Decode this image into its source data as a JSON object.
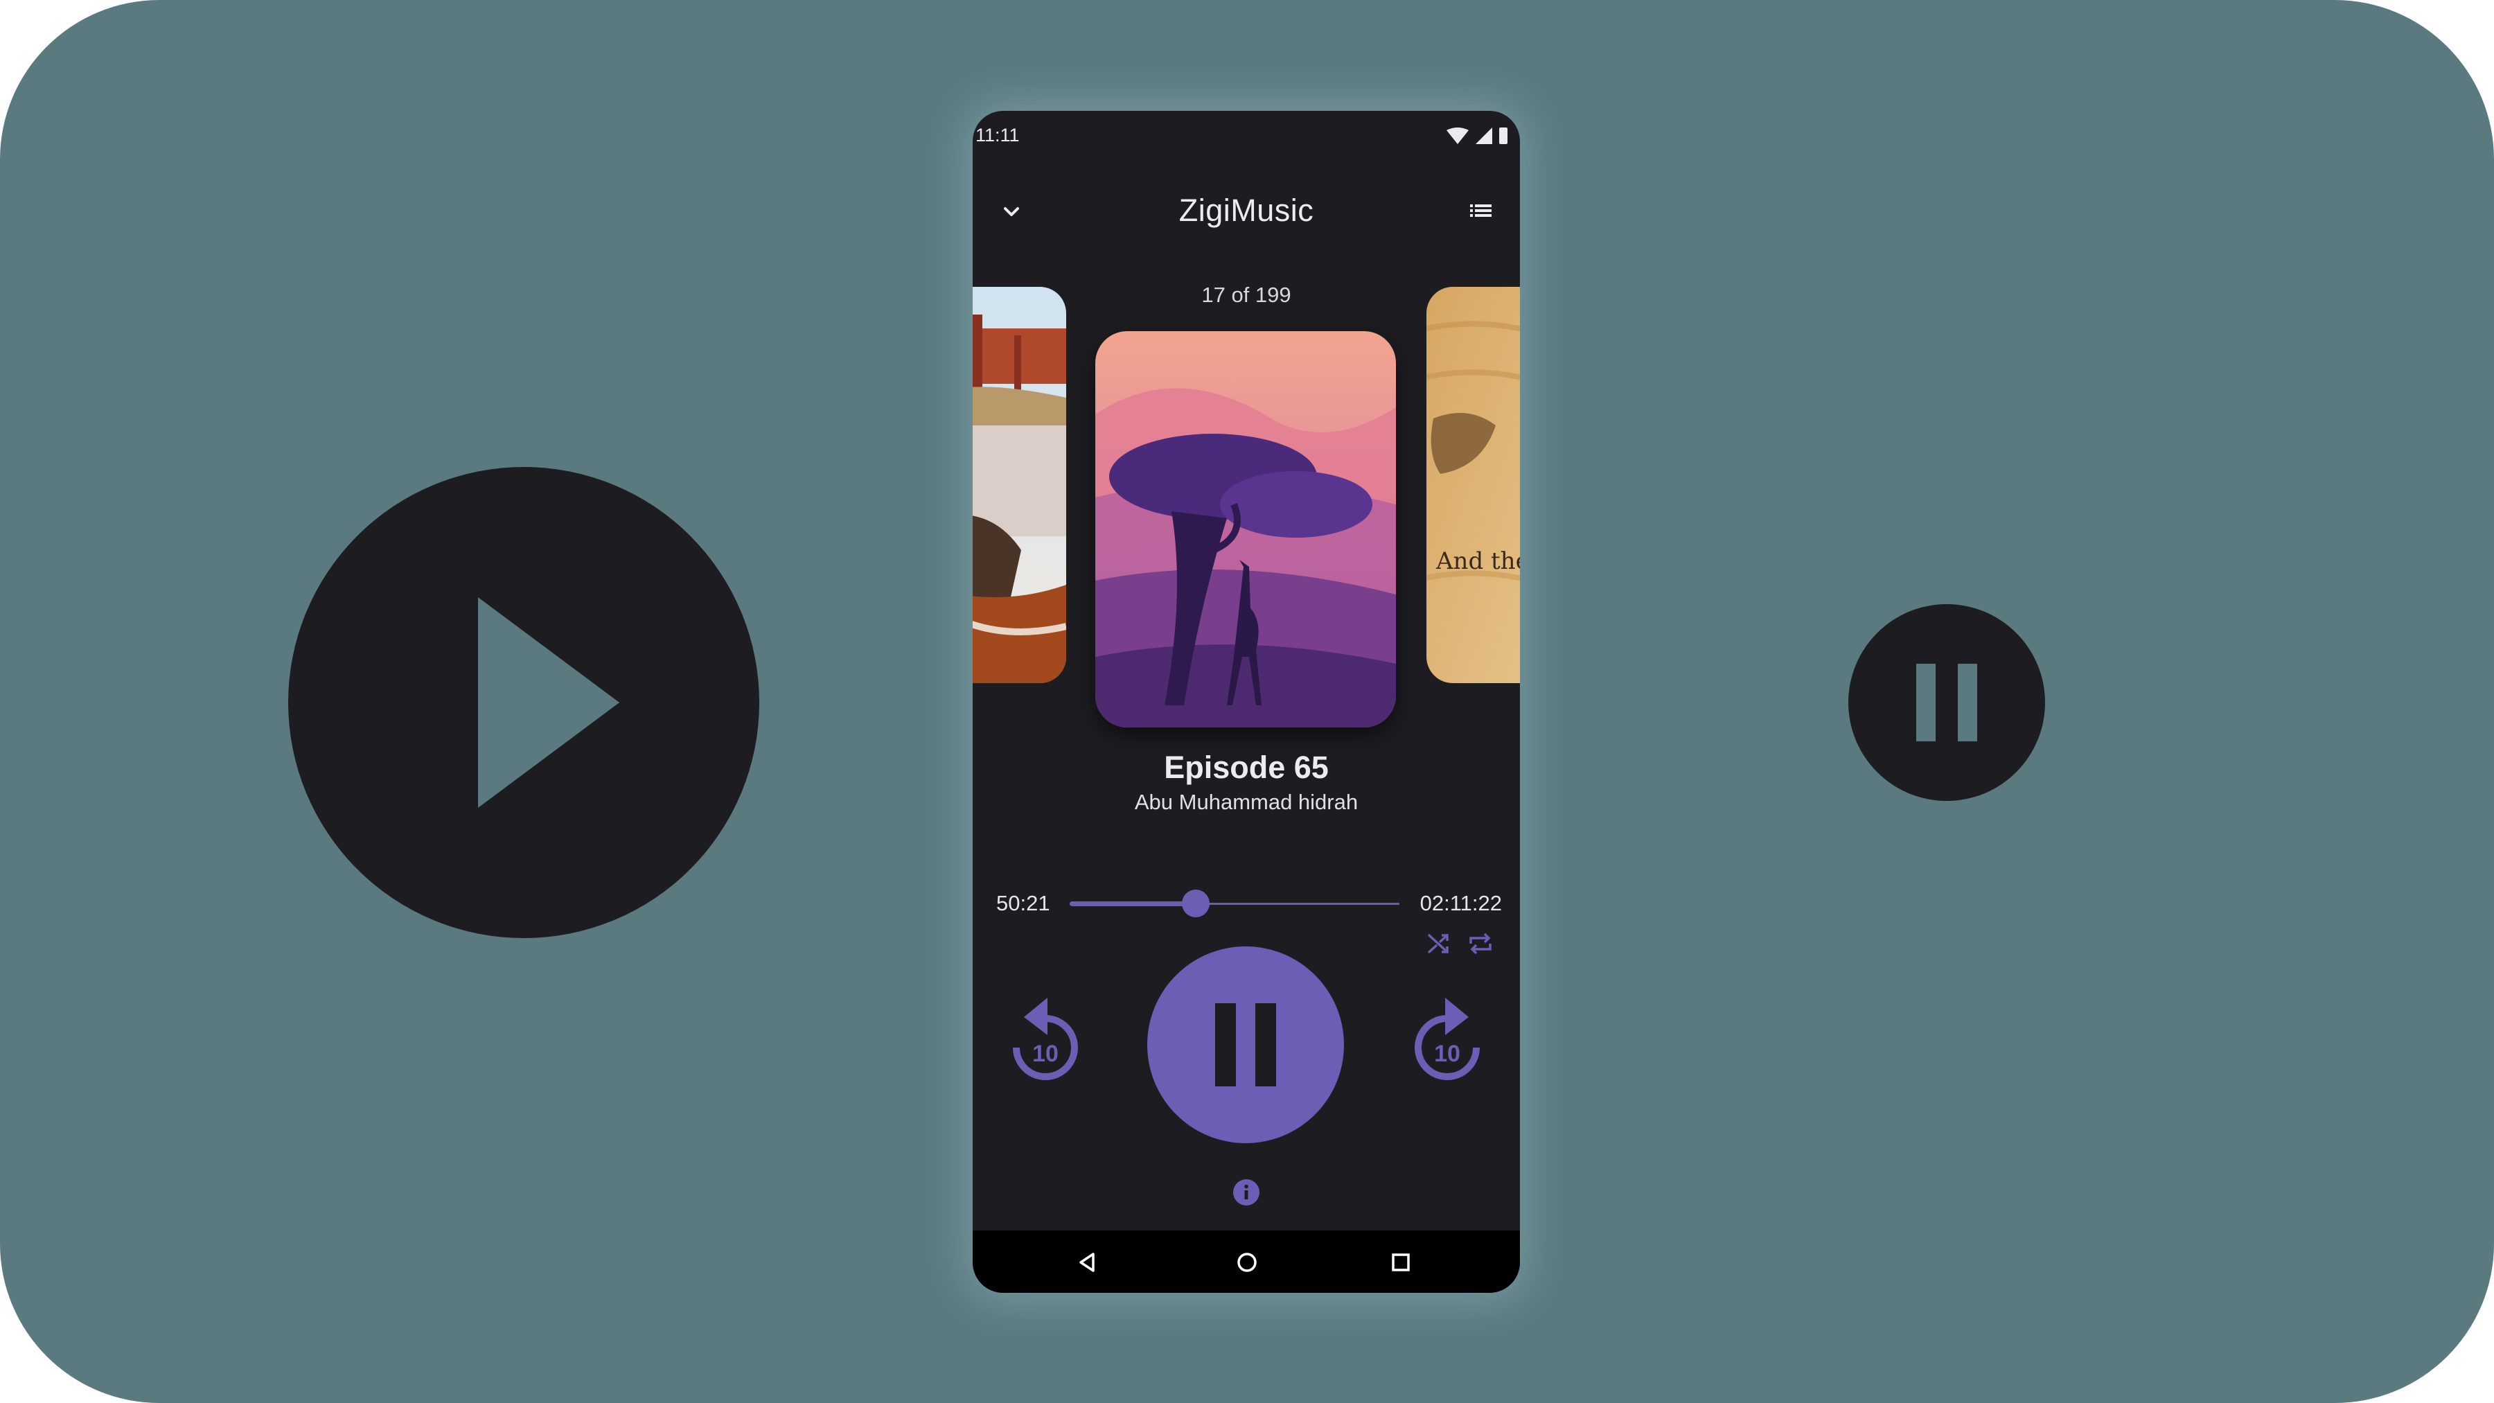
{
  "status_bar": {
    "time": "11:11",
    "icons": [
      "wifi-icon",
      "cellular-signal-icon",
      "battery-icon"
    ]
  },
  "app_bar": {
    "title": "ZigiMusic",
    "left_icon": "chevron-down-icon",
    "right_icon": "queue-list-icon"
  },
  "carousel": {
    "counter": "17 of 199",
    "right_cover_caption": "And the"
  },
  "track": {
    "title": "Episode 65",
    "author": "Abu Muhammad hidrah"
  },
  "playback": {
    "elapsed": "50:21",
    "duration": "02:11:22",
    "progress_fraction": 0.383,
    "rewind_label": "10",
    "forward_label": "10",
    "state": "playing"
  },
  "icons": {
    "shuffle": "shuffle-icon",
    "repeat": "repeat-icon",
    "info": "info-icon",
    "pause": "pause-icon",
    "big_play": "play-icon",
    "big_pause": "pause-icon"
  },
  "nav_bar": {
    "icons": [
      "nav-back-icon",
      "nav-home-icon",
      "nav-recents-icon"
    ]
  },
  "colors": {
    "background": "#5b7a80",
    "surface": "#1d1c21",
    "accent": "#6a5fb4",
    "text": "#ececf0"
  }
}
